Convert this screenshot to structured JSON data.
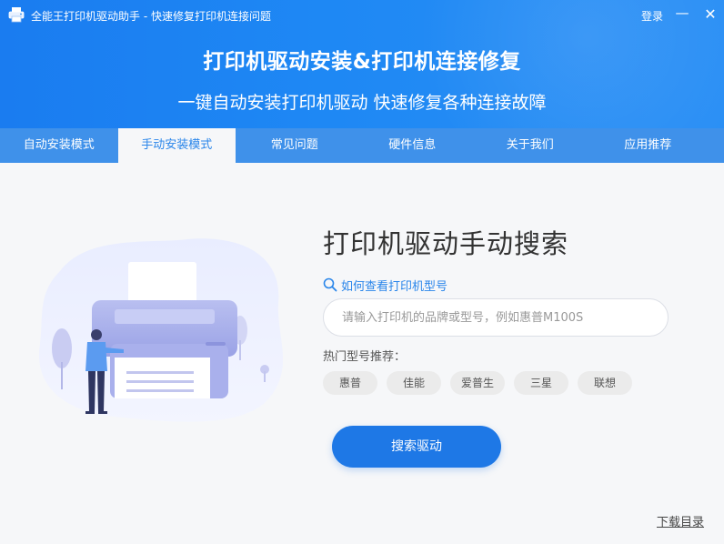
{
  "window": {
    "title": "全能王打印机驱动助手 - 快速修复打印机连接问题",
    "login_label": "登录",
    "minimize_glyph": "—",
    "close_glyph": "✕"
  },
  "banner": {
    "title": "打印机驱动安装&打印机连接修复",
    "subtitle": "一键自动安装打印机驱动 快速修复各种连接故障"
  },
  "tabs": [
    {
      "label": "自动安装模式",
      "active": false
    },
    {
      "label": "手动安装模式",
      "active": true
    },
    {
      "label": "常见问题",
      "active": false
    },
    {
      "label": "硬件信息",
      "active": false
    },
    {
      "label": "关于我们",
      "active": false
    },
    {
      "label": "应用推荐",
      "active": false
    }
  ],
  "main": {
    "title": "打印机驱动手动搜索",
    "howto_label": "如何查看打印机型号",
    "search": {
      "placeholder": "请输入打印机的品牌或型号，例如惠普M100S",
      "value": ""
    },
    "hot_label": "热门型号推荐：",
    "hot_models": [
      "惠普",
      "佳能",
      "爱普生",
      "三星",
      "联想"
    ],
    "search_button": "搜索驱动",
    "download_link": "下载目录"
  },
  "colors": {
    "header": "#1e88f4",
    "tab_bar": "#3f91ea",
    "accent": "#2a86ea",
    "button": "#1e78e6",
    "chip": "#ebebeb"
  },
  "icons": {
    "app": "printer-app-icon",
    "search": "magnifier-icon"
  }
}
